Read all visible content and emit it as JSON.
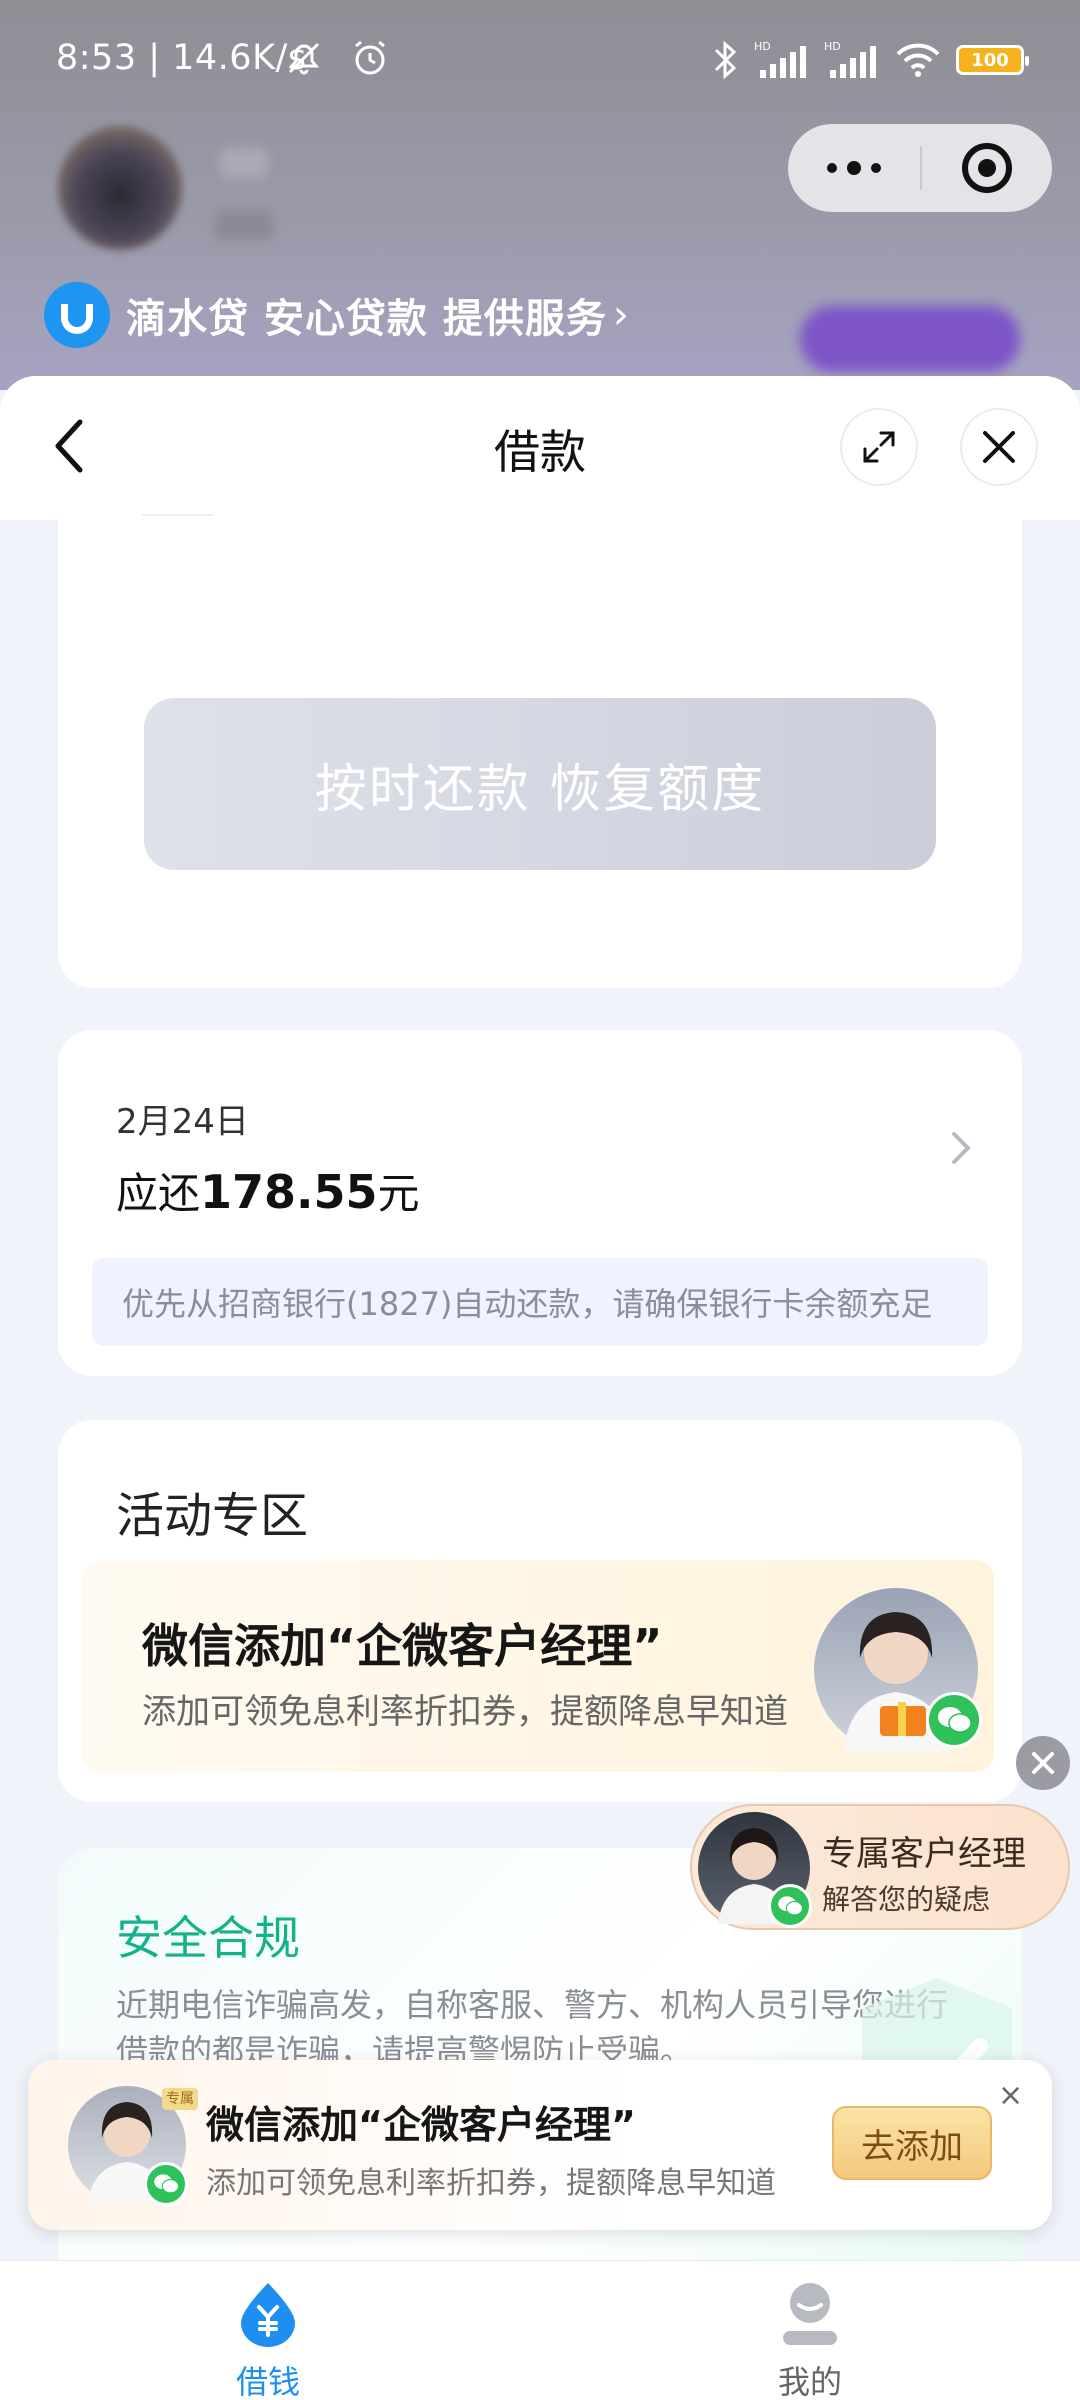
{
  "status_bar": {
    "time_speed": "8:53 | 14.6K/s",
    "battery": "100",
    "signal_label": "HD"
  },
  "provider": {
    "text": "滴水贷 安心贷款 提供服务",
    "chevron": "›"
  },
  "nav": {
    "title": "借款"
  },
  "repay_button": {
    "label": "按时还款 恢复额度"
  },
  "due": {
    "date": "2月24日",
    "prefix": "应还",
    "amount": "178.55",
    "unit": "元",
    "notice": "优先从招商银行(1827)自动还款，请确保银行卡余额充足"
  },
  "activity": {
    "title": "活动专区",
    "promo_title": "微信添加“企微客户经理”",
    "promo_sub": "添加可领免息利率折扣券，提额降息早知道"
  },
  "safety": {
    "title": "安全合规",
    "text": "近期电信诈骗高发，自称客服、警方、机构人员引导您进行借款的都是诈骗，请提高警惕防止受骗。"
  },
  "float_manager": {
    "title": "专属客户经理",
    "sub": "解答您的疑虑"
  },
  "banner": {
    "tag": "专属",
    "title": "微信添加“企微客户经理”",
    "sub": "添加可领免息利率折扣券，提额降息早知道",
    "button": "去添加",
    "close": "×"
  },
  "tabbar": {
    "borrow": "借钱",
    "mine": "我的"
  },
  "colors": {
    "accent": "#1e8ff0",
    "safe_green": "#14b28a",
    "wechat_green": "#2fc25b"
  }
}
